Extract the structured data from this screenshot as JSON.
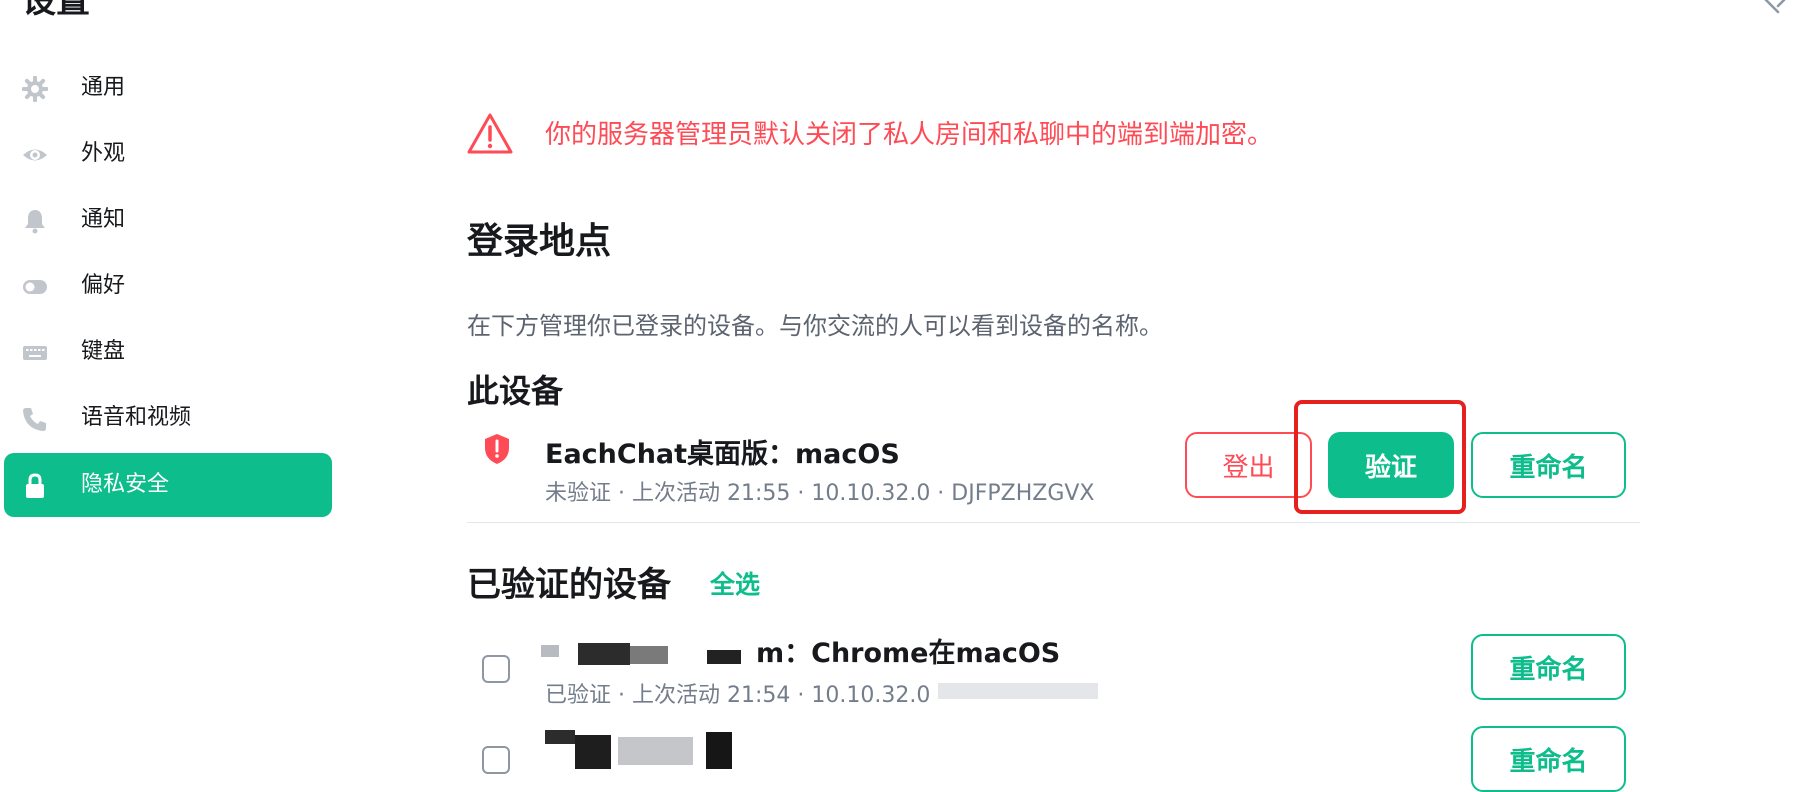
{
  "page_title": "设置",
  "sidebar": {
    "items": [
      {
        "label": "通用",
        "icon": "gear-icon"
      },
      {
        "label": "外观",
        "icon": "eye-icon"
      },
      {
        "label": "通知",
        "icon": "bell-icon"
      },
      {
        "label": "偏好",
        "icon": "toggle-icon"
      },
      {
        "label": "键盘",
        "icon": "keyboard-icon"
      },
      {
        "label": "语音和视频",
        "icon": "phone-icon"
      },
      {
        "label": "隐私安全",
        "icon": "lock-icon",
        "active": true
      }
    ]
  },
  "warning": {
    "text": "你的服务器管理员默认关闭了私人房间和私聊中的端到端加密。",
    "color": "#ff4b55"
  },
  "sessions": {
    "heading": "登录地点",
    "description": "在下方管理你已登录的设备。与你交流的人可以看到设备的名称。",
    "this_device": {
      "heading": "此设备",
      "name": "EachChat桌面版：macOS",
      "meta": "未验证 · 上次活动 21:55 · 10.10.32.0 · DJFPZHZGVX",
      "logout_label": "登出",
      "verify_label": "验证",
      "rename_label": "重命名"
    },
    "verified": {
      "heading": "已验证的设备",
      "select_all_label": "全选",
      "devices": [
        {
          "name_visible": "m：Chrome在macOS",
          "meta_visible": "已验证 · 上次活动 21:54 · 10.10.32.0 ·",
          "rename_label": "重命名"
        },
        {
          "name_visible": "",
          "meta_visible": "",
          "rename_label": "重命名"
        }
      ]
    }
  },
  "colors": {
    "accent": "#0dbd8b",
    "danger": "#ff4b55",
    "highlight": "#e5201f"
  }
}
